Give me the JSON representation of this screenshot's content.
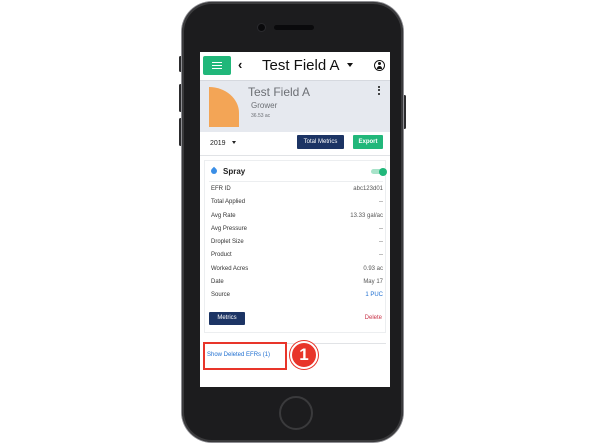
{
  "header": {
    "back_glyph": "‹",
    "title": "Test Field A"
  },
  "icons": {
    "menu": "hamburger-icon",
    "back": "chevron-left-icon",
    "title_dropdown": "caret-down-icon",
    "account": "user-circle-icon",
    "field_menu": "kebab-icon",
    "spray": "droplet-icon"
  },
  "field": {
    "name": "Test Field A",
    "grower": "Grower",
    "acres": "36.53 ac",
    "shape_color": "#f3a556"
  },
  "toolbar": {
    "year": "2019",
    "total_metrics_label": "Total Metrics",
    "export_label": "Export"
  },
  "spray": {
    "title": "Spray",
    "toggle_on": true,
    "rows": [
      {
        "label": "EFR ID",
        "value": "abc123d01"
      },
      {
        "label": "Total Applied",
        "value": "--"
      },
      {
        "label": "Avg Rate",
        "value": "13.33 gal/ac"
      },
      {
        "label": "Avg Pressure",
        "value": "--"
      },
      {
        "label": "Droplet Size",
        "value": "--"
      },
      {
        "label": "Product",
        "value": "--"
      },
      {
        "label": "Worked Acres",
        "value": "0.93 ac"
      },
      {
        "label": "Date",
        "value": "May 17"
      },
      {
        "label": "Source",
        "value": "1 PUC"
      }
    ],
    "metrics_label": "Metrics",
    "delete_label": "Delete"
  },
  "deleted": {
    "link_label": "Show Deleted EFRs (1)"
  },
  "annotation": {
    "step_number": "1"
  },
  "colors": {
    "accent_green": "#21b77a",
    "navy": "#1c3464",
    "link_blue": "#1f6fd1",
    "delete_red": "#c9344a",
    "annotation_red": "#e8352a"
  }
}
